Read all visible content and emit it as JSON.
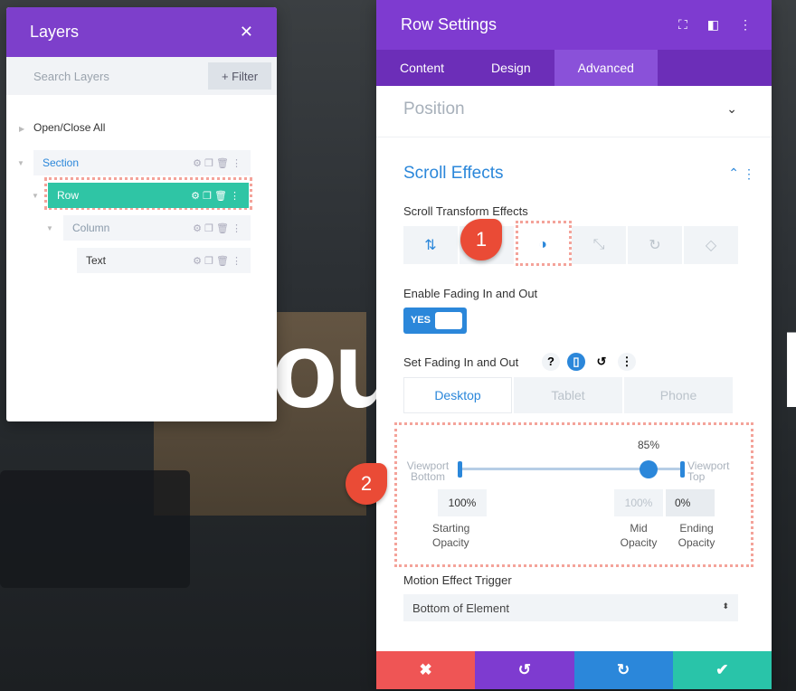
{
  "background": {
    "heading_fragment": "ou",
    "heading_fragment_right": "I"
  },
  "layers": {
    "title": "Layers",
    "close": "✕",
    "search_placeholder": "Search Layers",
    "filter_label": "+ Filter",
    "open_close_all": "Open/Close All",
    "items": [
      {
        "label": "Section",
        "color": "#2b87da"
      },
      {
        "label": "Row",
        "color": "#ffffff"
      },
      {
        "label": "Column",
        "color": "#8a9aaa"
      },
      {
        "label": "Text",
        "color": "#333333"
      }
    ]
  },
  "row_settings": {
    "title": "Row Settings",
    "tabs": [
      "Content",
      "Design",
      "Advanced"
    ],
    "active_tab": "Advanced",
    "position_label": "Position",
    "scroll_effects_label": "Scroll Effects",
    "scroll_transform_label": "Scroll Transform Effects",
    "effect_icons": [
      "vertical-motion",
      "fading",
      "scaling",
      "rotating",
      "blur"
    ],
    "enable_fading_label": "Enable Fading In and Out",
    "toggle_label": "YES",
    "set_fading_label": "Set Fading In and Out",
    "help": "?",
    "device_tabs": [
      "Desktop",
      "Tablet",
      "Phone"
    ],
    "slider": {
      "mid_value": "85%",
      "viewport_bottom": "Viewport Bottom",
      "viewport_top": "Viewport Top",
      "mid_position_percent": 85
    },
    "starting_opacity": "100%",
    "mid_opacity": "100%",
    "ending_opacity": "0%",
    "starting_label": "Starting Opacity",
    "mid_label": "Mid Opacity",
    "ending_label": "Ending Opacity",
    "motion_trigger_label": "Motion Effect Trigger",
    "motion_trigger_value": "Bottom of Element",
    "footer": [
      "✖",
      "↺",
      "↻",
      "✔"
    ]
  },
  "annotations": [
    "1",
    "2"
  ],
  "colors": {
    "purple": "#7e3bd0",
    "blue": "#2b87da",
    "red": "#ef5555",
    "green": "#29c4a9",
    "teal": "#2fc5a5"
  }
}
